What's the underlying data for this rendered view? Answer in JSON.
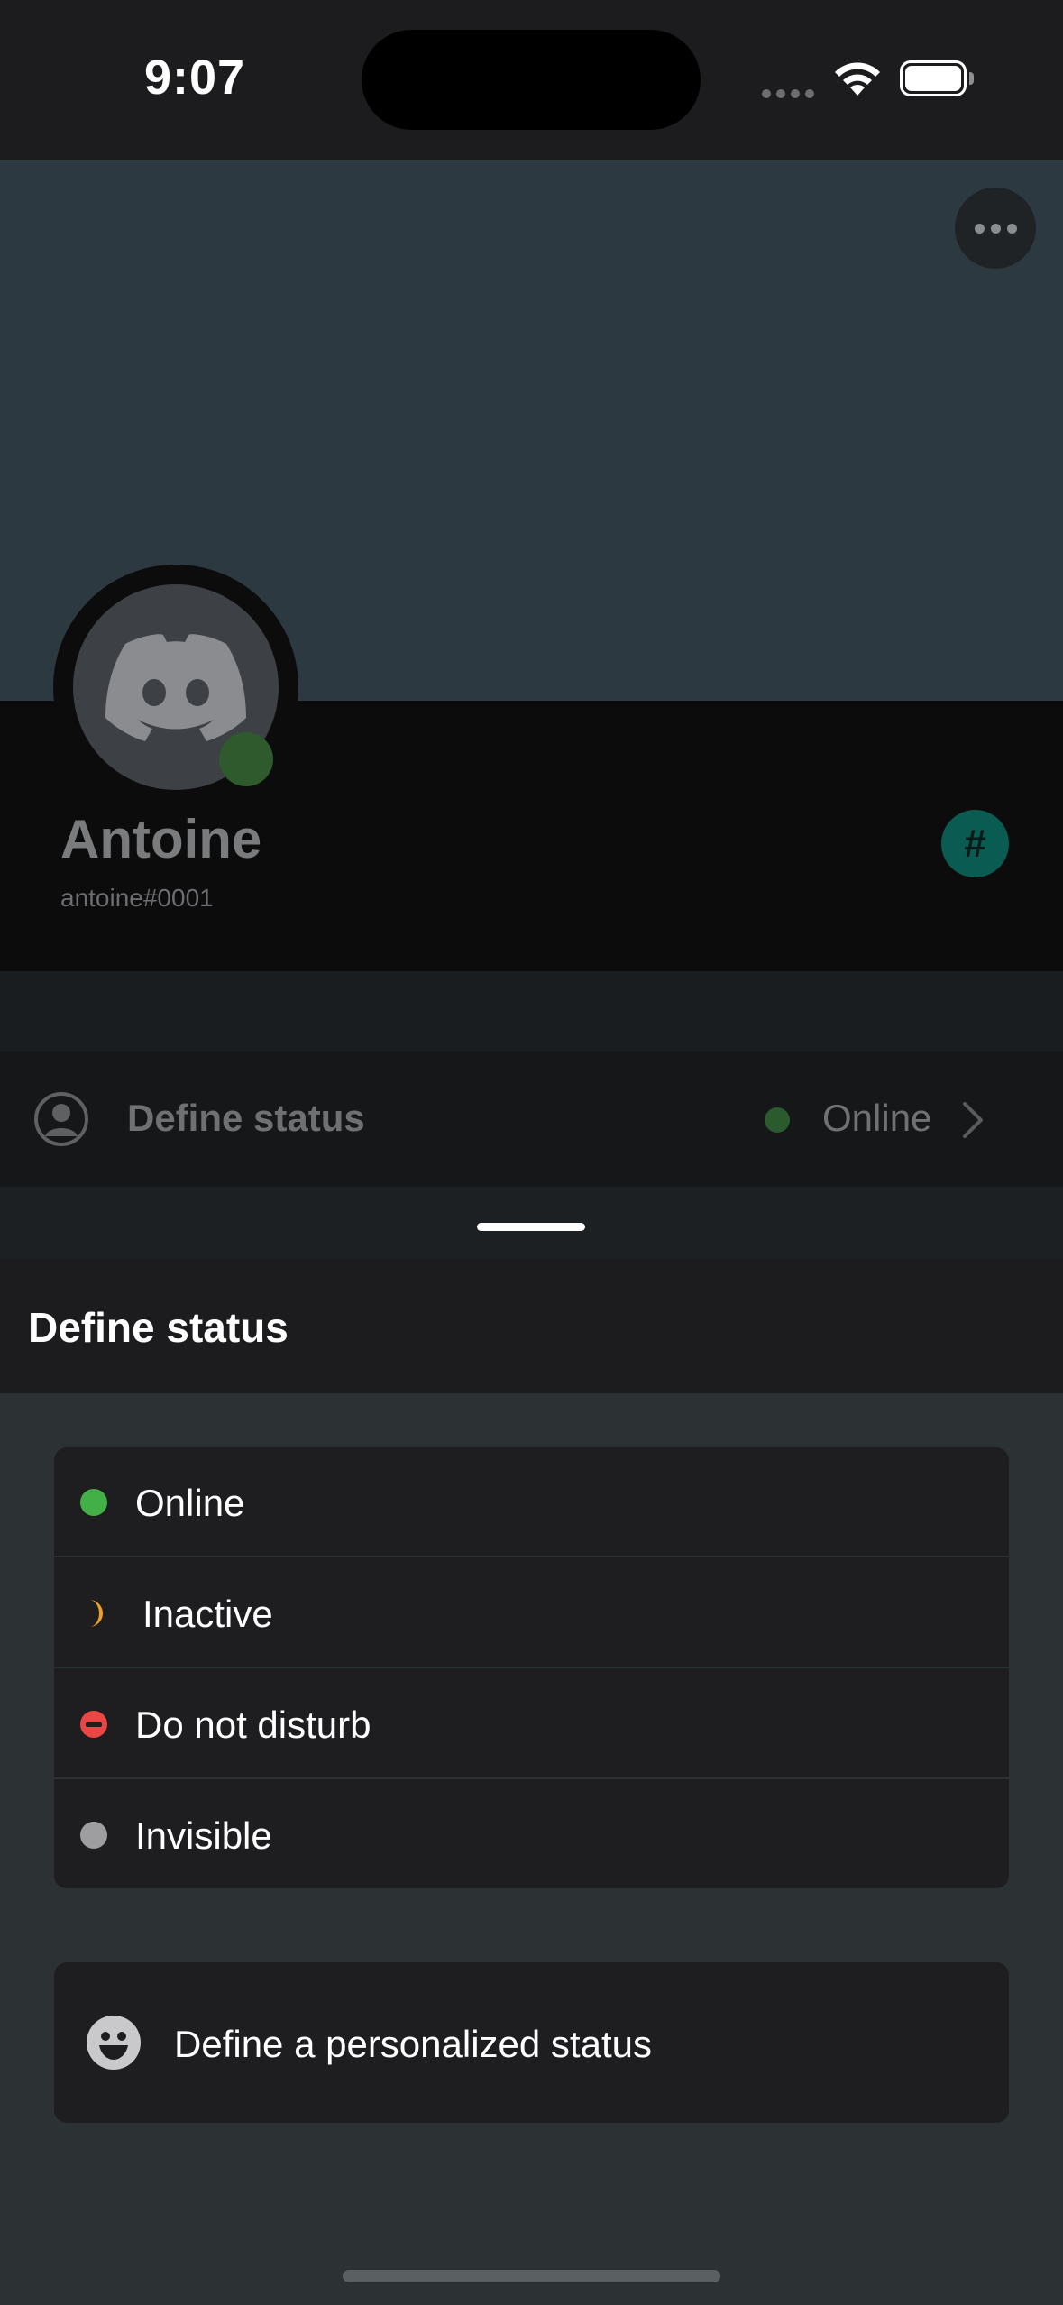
{
  "status_bar": {
    "time": "9:07",
    "icons": [
      "cellular-signal-icon",
      "wifi-icon",
      "battery-icon"
    ]
  },
  "profile": {
    "more_icon": "ellipsis-icon",
    "avatar_icon": "discord-logo-icon",
    "name": "Antoine",
    "tag": "antoine#0001",
    "badge": "#",
    "status_row": {
      "label": "Define status",
      "value": "Online",
      "icons": [
        "person-circle-icon",
        "chevron-right-icon"
      ]
    }
  },
  "sheet": {
    "title": "Define status",
    "options": [
      {
        "label": "Online",
        "icon": "online-dot-icon",
        "color": "#43b047"
      },
      {
        "label": "Inactive",
        "icon": "moon-icon",
        "color": "#f0a020"
      },
      {
        "label": "Do not disturb",
        "icon": "do-not-disturb-icon",
        "color": "#ec4545"
      },
      {
        "label": "Invisible",
        "icon": "invisible-dot-icon",
        "color": "#9e9ea0"
      }
    ],
    "custom_status": {
      "label": "Define a personalized status",
      "icon": "smiley-icon"
    }
  },
  "colors": {
    "banner": "#2d3941",
    "sheet_background": "#2c3234",
    "card": "#1e1e20",
    "badge": "#0a5c52"
  }
}
